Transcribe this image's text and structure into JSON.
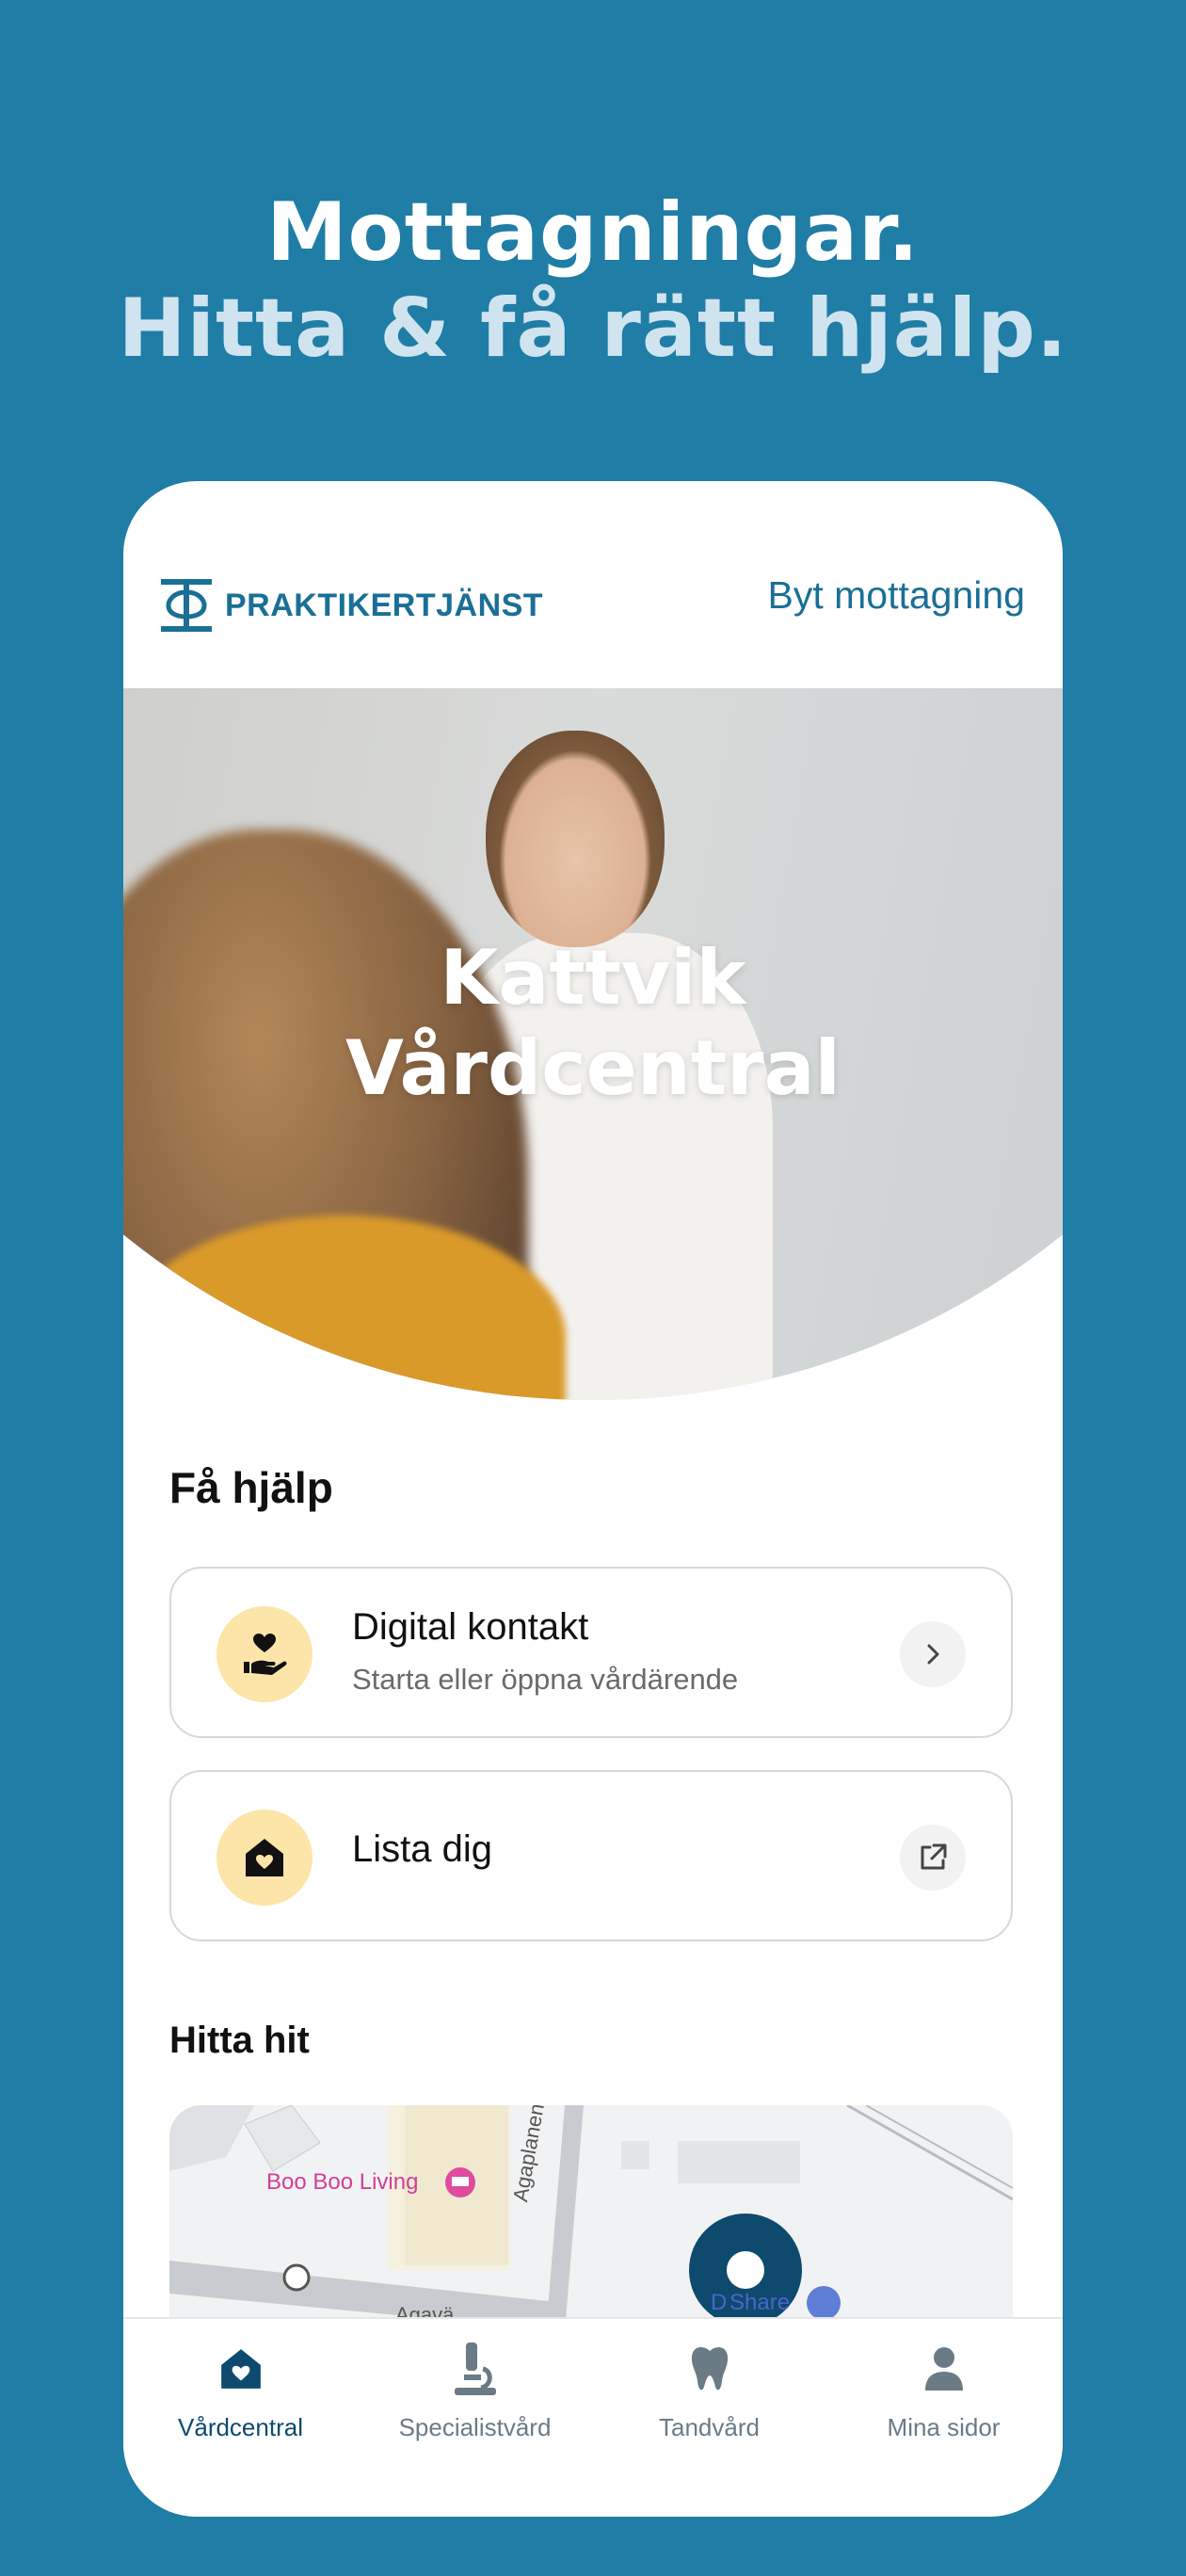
{
  "headline": {
    "line1": "Mottagningar.",
    "line2": "Hitta & få rätt hjälp."
  },
  "header": {
    "brand": "PRAKTIKERTJÄNST",
    "switch_label": "Byt mottagning"
  },
  "hero": {
    "title_line1": "Kattvik",
    "title_line2": "Vårdcentral"
  },
  "help": {
    "title": "Få hjälp",
    "cards": [
      {
        "title": "Digital kontakt",
        "subtitle": "Starta eller öppna vårdärende",
        "icon": "heart-hand-icon",
        "action_icon": "chevron-right-icon"
      },
      {
        "title": "Lista dig",
        "icon": "home-heart-icon",
        "action_icon": "external-link-icon"
      }
    ]
  },
  "find": {
    "title": "Hitta hit",
    "map": {
      "poi_1": "Boo Boo Living",
      "poi_2": "Share",
      "poi_2_prefix": "D",
      "road_1": "Agaplanen",
      "road_2": "Agavä"
    }
  },
  "tabs": [
    {
      "label": "Vårdcentral",
      "icon": "home-heart-icon",
      "active": true
    },
    {
      "label": "Specialistvård",
      "icon": "microscope-icon",
      "active": false
    },
    {
      "label": "Tandvård",
      "icon": "tooth-icon",
      "active": false
    },
    {
      "label": "Mina sidor",
      "icon": "user-icon",
      "active": false
    }
  ],
  "colors": {
    "background": "#1f7da6",
    "brand": "#1a6f96",
    "icon_bg": "#fde5a9",
    "tab_active": "#0d4a6e",
    "tab_inactive": "#6a7b86"
  }
}
